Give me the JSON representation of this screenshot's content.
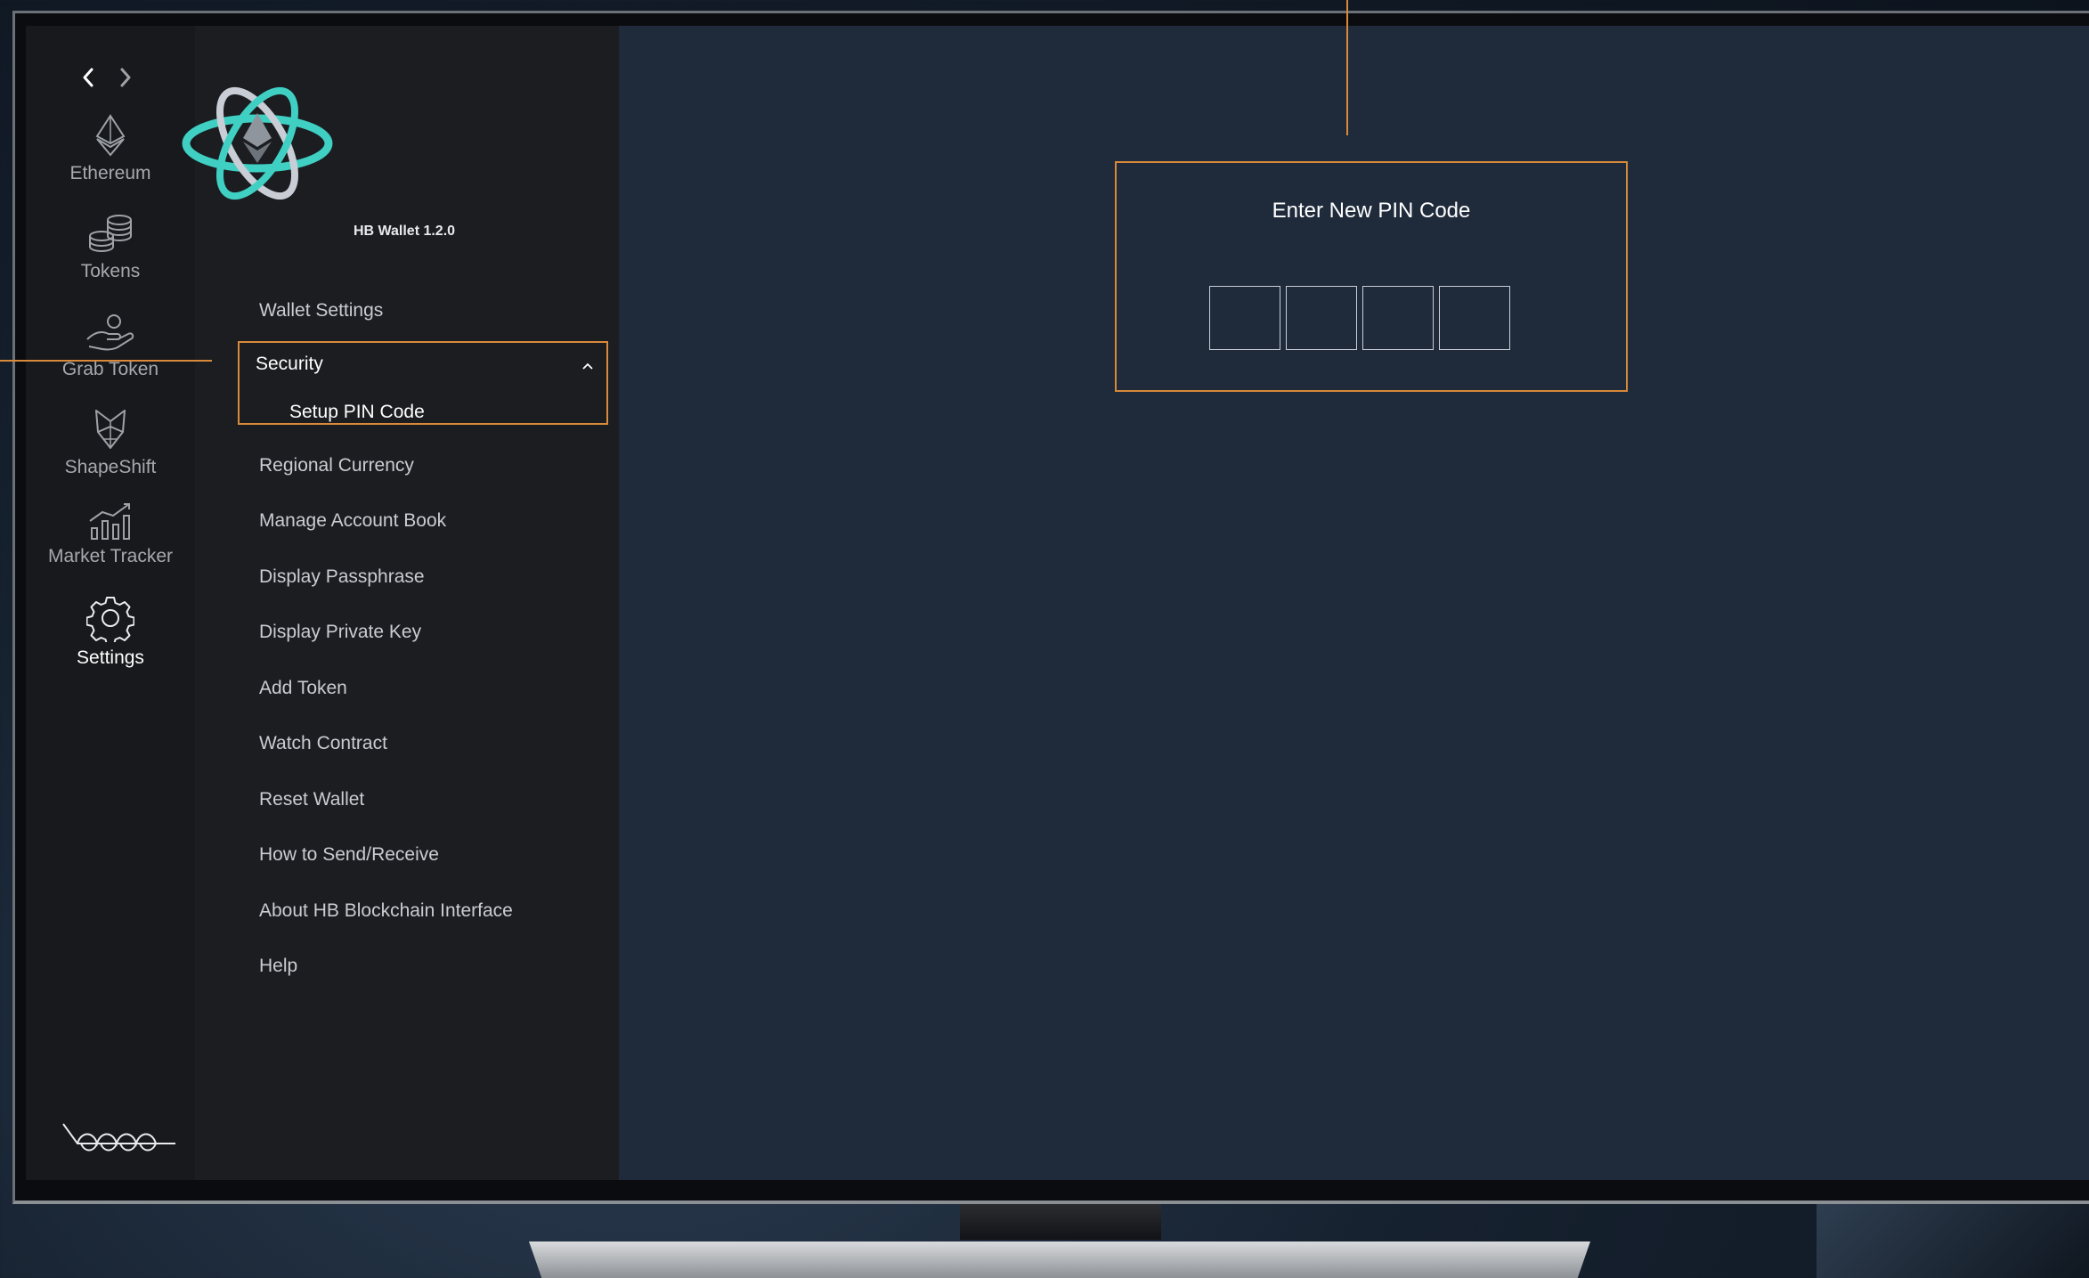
{
  "app": {
    "version_label": "HB Wallet 1.2.0"
  },
  "nav": {
    "back_icon": "chevron-left-icon",
    "forward_icon": "chevron-right-icon"
  },
  "rail": {
    "items": [
      {
        "label": "Ethereum",
        "icon": "ethereum-icon"
      },
      {
        "label": "Tokens",
        "icon": "coins-icon"
      },
      {
        "label": "Grab Token",
        "icon": "hand-coin-icon"
      },
      {
        "label": "ShapeShift",
        "icon": "fox-icon"
      },
      {
        "label": "Market Tracker",
        "icon": "chart-icon"
      },
      {
        "label": "Settings",
        "icon": "gear-icon",
        "active": true
      }
    ],
    "brand_icon": "hb-brand-logo"
  },
  "settings_menu": {
    "wallet_settings": "Wallet Settings",
    "security": {
      "label": "Security",
      "expanded": true,
      "sub_item": "Setup PIN Code"
    },
    "items": [
      "Regional Currency",
      "Manage Account Book",
      "Display Passphrase",
      "Display Private Key",
      "Add Token",
      "Watch Contract",
      "Reset Wallet",
      "How to Send/Receive",
      "About HB Blockchain Interface",
      "Help"
    ]
  },
  "pin_dialog": {
    "title": "Enter New PIN Code",
    "digit_count": 4
  },
  "colors": {
    "accent_orange": "#d8893a",
    "screen_bg": "#1f2a3b",
    "rail_bg": "#17191c",
    "menu_bg": "#1b1d21",
    "logo_teal": "#3fd0c3"
  }
}
